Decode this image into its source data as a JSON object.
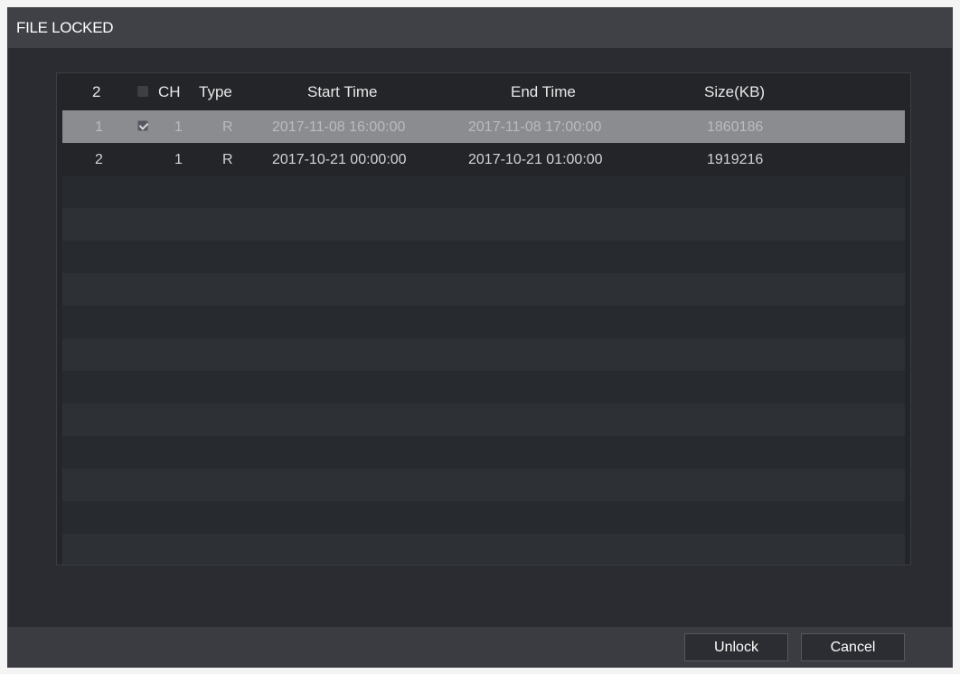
{
  "dialog": {
    "title": "FILE LOCKED"
  },
  "table": {
    "columns": {
      "index": "2",
      "ch": "CH",
      "type": "Type",
      "start_time": "Start Time",
      "end_time": "End Time",
      "size": "Size(KB)"
    },
    "rows": [
      {
        "index": "1",
        "checked": true,
        "selected": true,
        "ch": "1",
        "type": "R",
        "start_time": "2017-11-08 16:00:00",
        "end_time": "2017-11-08 17:00:00",
        "size": "1860186"
      },
      {
        "index": "2",
        "checked": false,
        "selected": false,
        "ch": "1",
        "type": "R",
        "start_time": "2017-10-21 00:00:00",
        "end_time": "2017-10-21 01:00:00",
        "size": "1919216"
      }
    ]
  },
  "footer": {
    "unlock_label": "Unlock",
    "cancel_label": "Cancel"
  }
}
